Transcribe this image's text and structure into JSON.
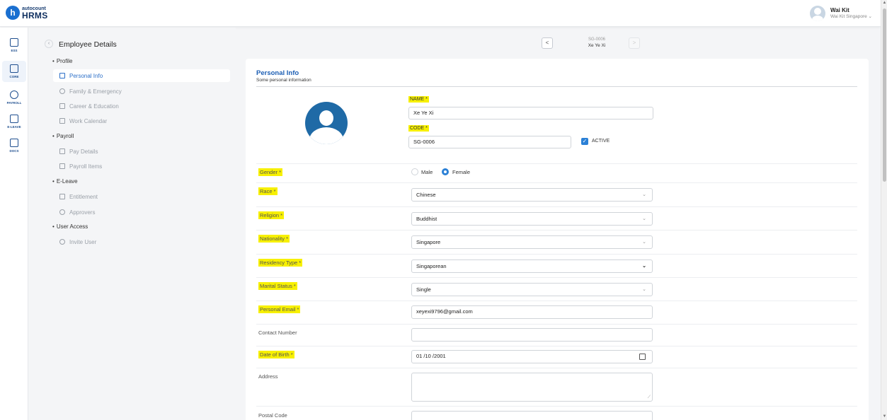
{
  "app": {
    "logo_letter": "h",
    "brand_top": "autocount",
    "brand_bottom": "HRMS"
  },
  "user": {
    "name": "Wai Kit",
    "org": "Wai Kit Singapore"
  },
  "rail": [
    {
      "label": "ESS"
    },
    {
      "label": "CORE"
    },
    {
      "label": "PAYROLL"
    },
    {
      "label": "E-LEAVE"
    },
    {
      "label": "DOCS"
    }
  ],
  "page": {
    "title": "Employee Details"
  },
  "sidebar": {
    "sections": [
      {
        "title": "Profile"
      },
      {
        "title": "Payroll"
      },
      {
        "title": "E-Leave"
      },
      {
        "title": "User Access"
      }
    ],
    "items": [
      {
        "label": "Personal Info"
      },
      {
        "label": "Family & Emergency"
      },
      {
        "label": "Career & Education"
      },
      {
        "label": "Work Calendar"
      },
      {
        "label": "Pay Details"
      },
      {
        "label": "Payroll Items"
      },
      {
        "label": "Entitlement"
      },
      {
        "label": "Approvers"
      },
      {
        "label": "Invite User"
      }
    ]
  },
  "record": {
    "code": "SG-0006",
    "name": "Xe Ye Xi",
    "prev": "<",
    "next": ">"
  },
  "form": {
    "title": "Personal Info",
    "subtitle": "Some personal information",
    "name_label": "NAME *",
    "name_value": "Xe Ye Xi",
    "code_label": "CODE *",
    "code_value": "SG-0006",
    "active_label": "ACTIVE",
    "gender_label": "Gender *",
    "gender_male": "Male",
    "gender_female": "Female",
    "race_label": "Race *",
    "race_value": "Chinese",
    "religion_label": "Religion *",
    "religion_value": "Buddhist",
    "nationality_label": "Nationality *",
    "nationality_value": "Singapore",
    "residency_label": "Residency Type *",
    "residency_value": "Singaporean",
    "marital_label": "Marital Status *",
    "marital_value": "Single",
    "email_label": "Personal Email *",
    "email_value": "xeyexi9796@gmail.com",
    "contact_label": "Contact Number",
    "contact_value": "",
    "dob_label": "Date of Birth *",
    "dob_value": "01 /10 /2001",
    "address_label": "Address",
    "postal_label": "Postal Code"
  },
  "colors": {
    "accent": "#2b80d6",
    "highlight": "#f7f000",
    "title_blue": "#1d5fb4"
  }
}
